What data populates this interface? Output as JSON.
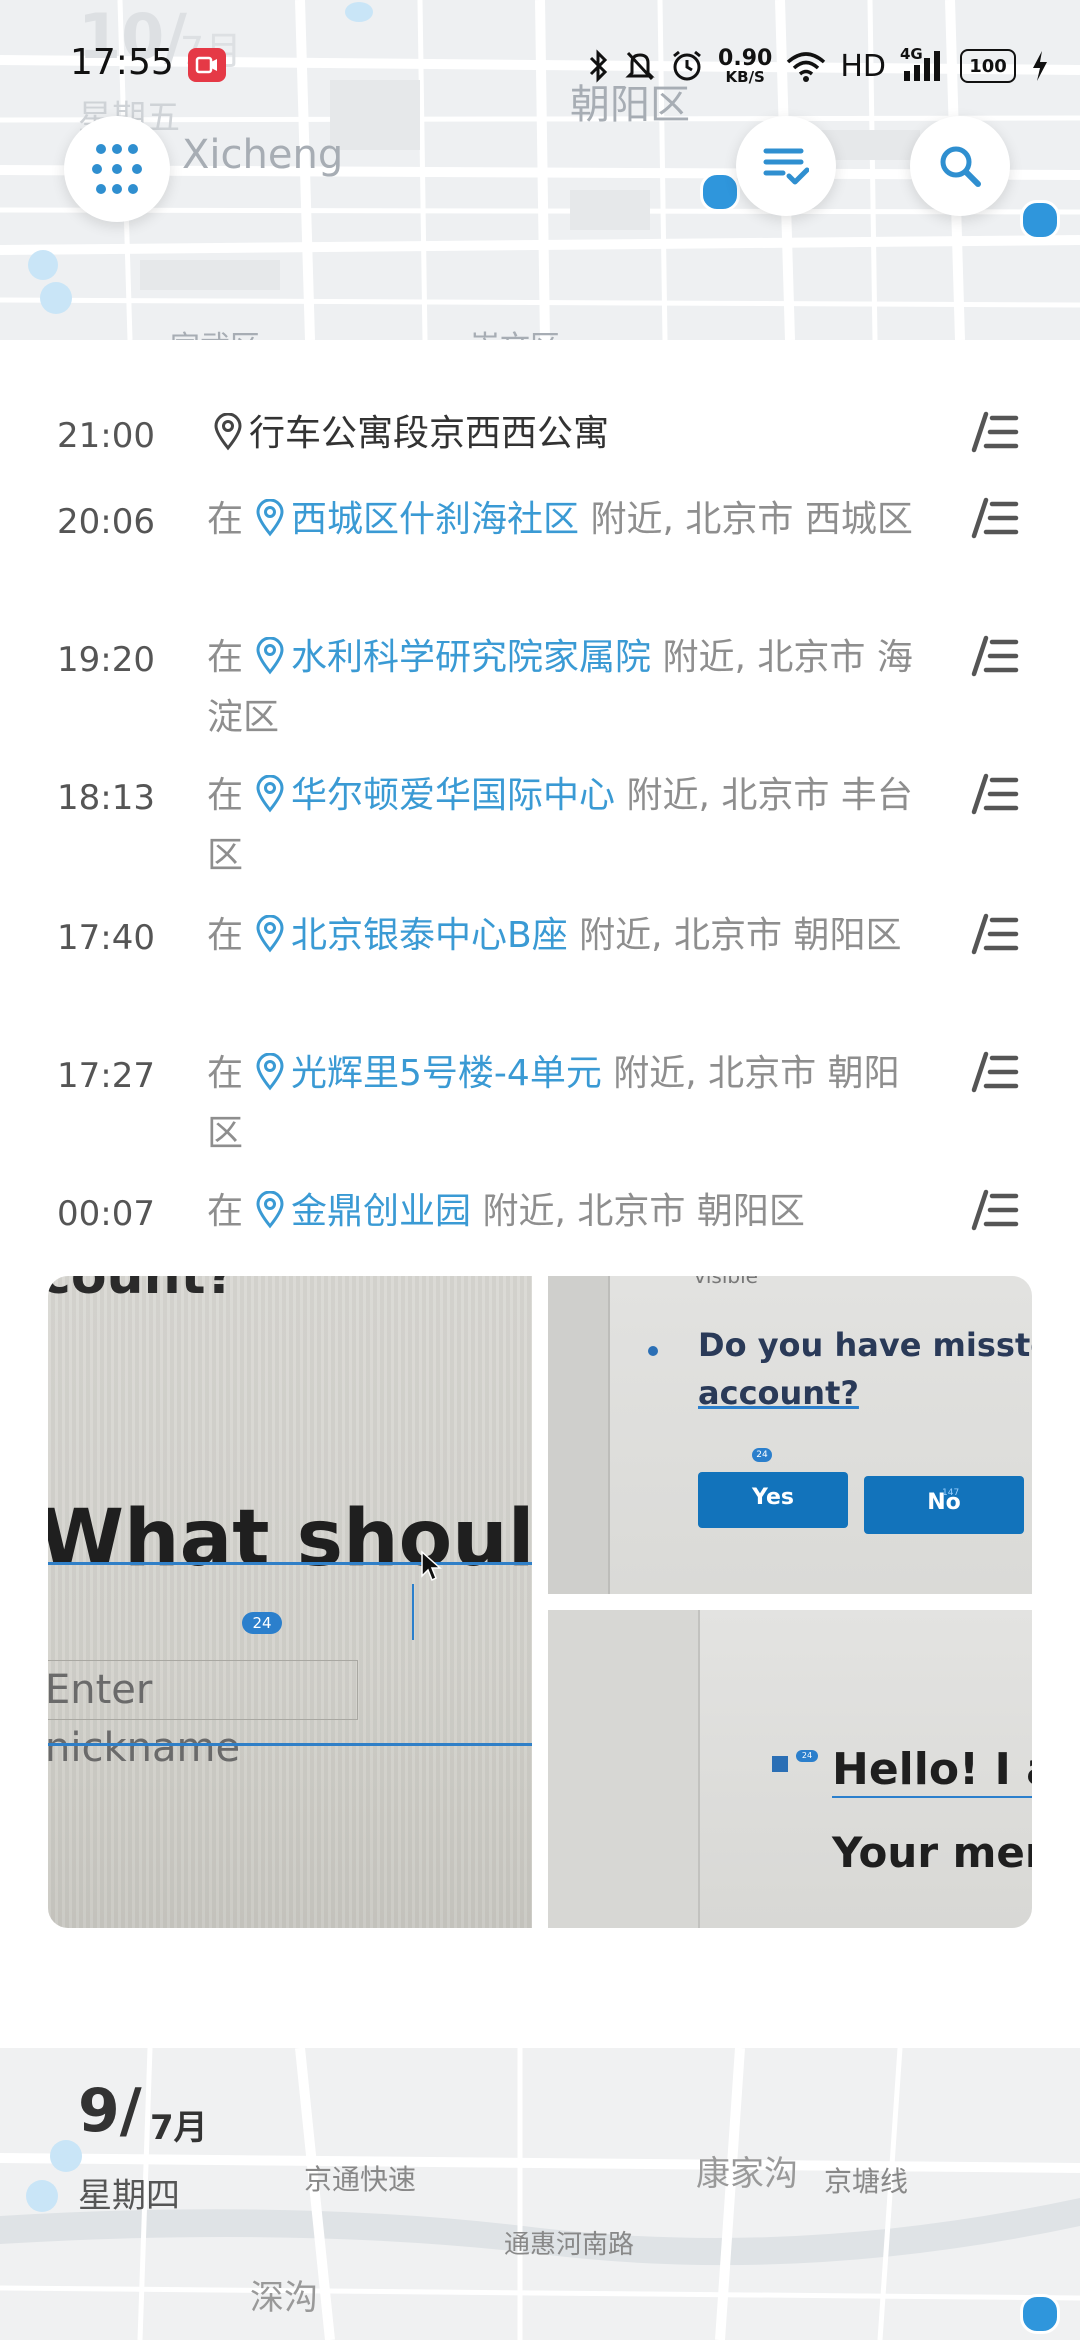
{
  "status_bar": {
    "time": "17:55",
    "net_speed_value": "0.90",
    "net_speed_unit": "KB/S",
    "hd_label": "HD",
    "network_type": "4G",
    "battery": "100"
  },
  "top_card": {
    "day": "10/",
    "month": "7月",
    "weekday": "星期五",
    "map_labels": [
      "Xicheng",
      "朝阳区",
      "宣武区",
      "崇文区"
    ]
  },
  "timeline": [
    {
      "time": "21:00",
      "prefix": "",
      "place": "行车公寓段京西西公寓",
      "suffix": ""
    },
    {
      "time": "20:06",
      "prefix": "在",
      "place": "西城区什刹海社区",
      "suffix": "附近, 北京市 西城区"
    },
    {
      "time": "19:20",
      "prefix": "在",
      "place": "水利科学研究院家属院",
      "suffix": "附近, 北京市 海淀区"
    },
    {
      "time": "18:13",
      "prefix": "在",
      "place": "华尔顿爱华国际中心",
      "suffix": "附近, 北京市 丰台区"
    },
    {
      "time": "17:40",
      "prefix": "在",
      "place": "北京银泰中心B座",
      "suffix": "附近, 北京市 朝阳区"
    },
    {
      "time": "17:27",
      "prefix": "在",
      "place": "光辉里5号楼-4单元",
      "suffix": "附近, 北京市 朝阳区"
    },
    {
      "time": "00:07",
      "prefix": "在",
      "place": "金鼎创业园",
      "suffix": "附近, 北京市 朝阳区"
    }
  ],
  "photos": {
    "left": {
      "line1": "count?",
      "line2": "What should I c",
      "badge": "24",
      "input": "Enter nickname"
    },
    "top_right": {
      "small": "visible",
      "question1": "Do you have missto",
      "question2": "account?",
      "badge": "24",
      "yes": "Yes",
      "no": "No",
      "no_badge": "147"
    },
    "bottom_right": {
      "line1": "Hello! I a",
      "line2": "Your mer",
      "badge": "24"
    }
  },
  "bottom_card": {
    "day": "9/",
    "month": "7月",
    "weekday": "星期四",
    "map_labels": [
      "京通快速",
      "康家沟",
      "京塘线",
      "通惠河南路",
      "深沟"
    ]
  },
  "colors": {
    "accent": "#3a9ad4",
    "primary_icon": "#2f8fd0",
    "text_gray": "#8e8e8e",
    "record_red": "#e53946"
  },
  "icons": [
    "grid-dots-icon",
    "list-check-icon",
    "search-icon",
    "location-pin-icon",
    "note-edit-icon",
    "bluetooth-icon",
    "mute-bell-icon",
    "alarm-icon",
    "wifi-icon",
    "signal-icon",
    "battery-icon",
    "charging-icon"
  ]
}
